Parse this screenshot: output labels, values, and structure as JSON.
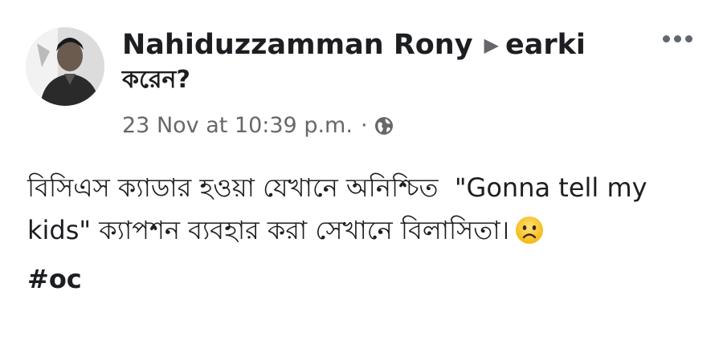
{
  "post": {
    "author_name": "Nahiduzzamman Rony",
    "group_arrow": "▶",
    "group_name_part1": "earki",
    "group_name_part2": "করেন?",
    "timestamp": "23 Nov at 10:39 p.m.",
    "separator": "·",
    "privacy_icon": "globe-icon",
    "more_icon": "more-options-icon",
    "body_text": "বিসিএস ক্যাডার হওয়া যেখানে অনিশ্চিত  \"Gonna tell my kids\" ক্যাপশন ব্যবহার করা সেখানে বিলাসিতা।",
    "emoji_icon": "frowning-face-icon",
    "hashtag": "#oc"
  }
}
